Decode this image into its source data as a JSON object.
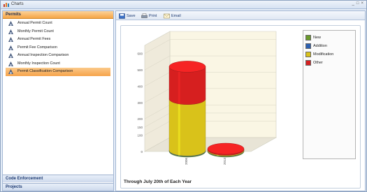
{
  "window": {
    "title": "Charts",
    "controls": [
      "_",
      "□",
      "×"
    ]
  },
  "sidebar": {
    "active_section": "Permits",
    "items": [
      {
        "label": "Annual Permit Count"
      },
      {
        "label": "Monthly Permit Count"
      },
      {
        "label": "Annual Permit Fees"
      },
      {
        "label": "Permit Fee Comparison"
      },
      {
        "label": "Annual Inspection Comparison"
      },
      {
        "label": "Monthly Inspection Count"
      },
      {
        "label": "Permit Classification Comparison",
        "selected": true
      }
    ],
    "sections": [
      "Code Enforcement",
      "Projects"
    ]
  },
  "toolbar": {
    "save_label": "Save",
    "print_label": "Print",
    "email_label": "Email"
  },
  "chart_data": {
    "type": "bar",
    "stacked": true,
    "style": "3d-cylinder",
    "categories": [
      "2006",
      "2013"
    ],
    "series": [
      {
        "name": "New",
        "color": "#6a9a2a",
        "values": [
          4,
          4
        ]
      },
      {
        "name": "Addition",
        "color": "#2c5fb0",
        "values": [
          3,
          2
        ]
      },
      {
        "name": "Modification",
        "color": "#d9c21a",
        "values": [
          315,
          5
        ]
      },
      {
        "name": "Other",
        "color": "#d61f1f",
        "values": [
          198,
          6
        ]
      }
    ],
    "yticks": [
      0,
      100,
      150,
      200,
      300,
      400,
      500,
      600
    ],
    "ylim": [
      0,
      650
    ],
    "grid": true,
    "legend_position": "right",
    "footnote": "Through July 20th of Each Year"
  }
}
